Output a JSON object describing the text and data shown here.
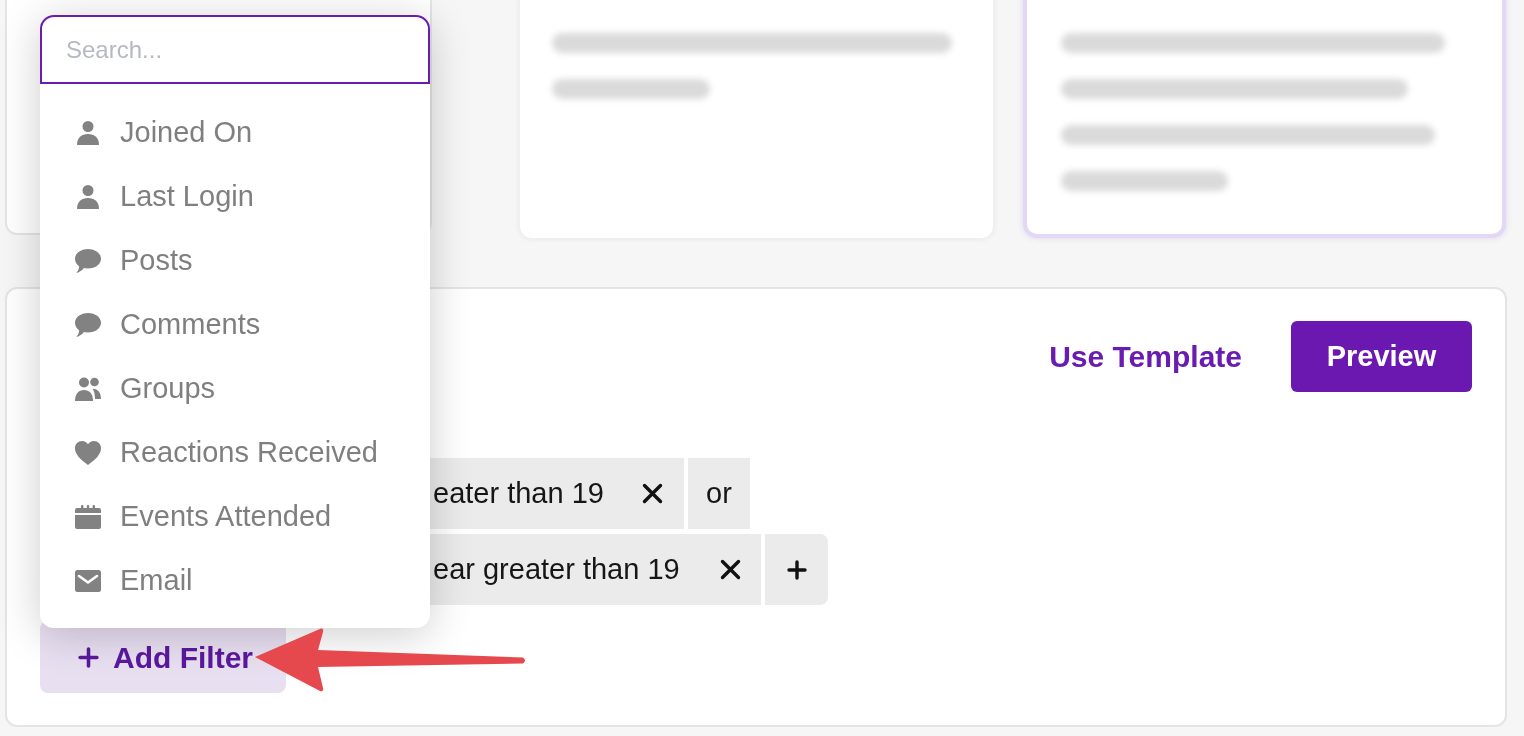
{
  "option_cards": [
    {
      "selected": false
    },
    {
      "selected": true
    }
  ],
  "actions": {
    "link": "Use Template",
    "button": "Preview"
  },
  "filter_rows": [
    {
      "condition": "eater than 19",
      "end": {
        "kind": "operator",
        "label": "or"
      }
    },
    {
      "condition": "ear greater than 19",
      "end": {
        "kind": "add"
      }
    }
  ],
  "add_filter": {
    "label": "Add Filter"
  },
  "dropdown": {
    "search": {
      "placeholder": "Search..."
    },
    "options": [
      {
        "label": "Joined On",
        "kind": "person"
      },
      {
        "label": "Last Login",
        "kind": "person"
      },
      {
        "label": "Posts",
        "kind": "speech"
      },
      {
        "label": "Comments",
        "kind": "speech"
      },
      {
        "label": "Groups",
        "kind": "people"
      },
      {
        "label": "Reactions Received",
        "kind": "heart"
      },
      {
        "label": "Events Attended",
        "kind": "calendar"
      },
      {
        "label": "Email",
        "kind": "mail"
      }
    ]
  }
}
